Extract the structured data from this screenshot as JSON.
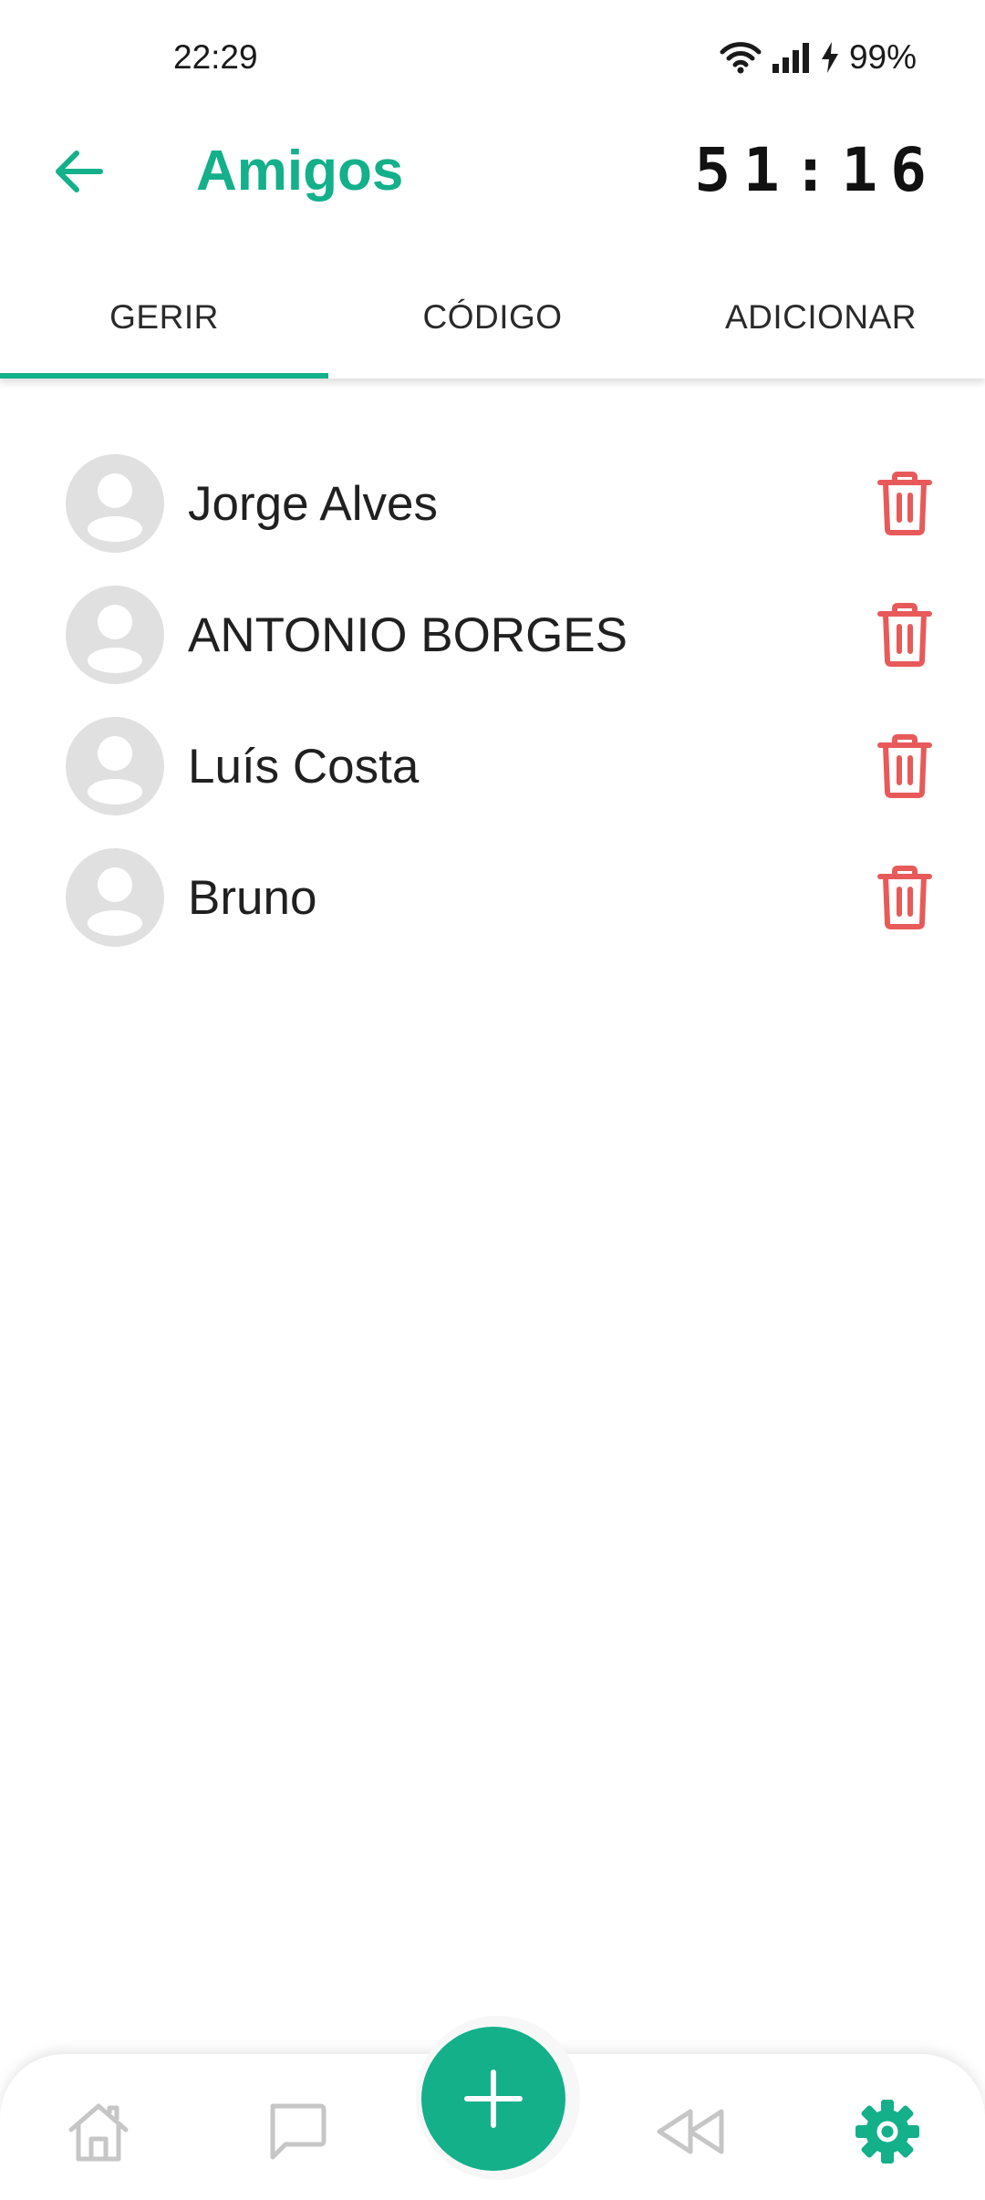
{
  "status_bar": {
    "time": "22:29",
    "battery": "99%"
  },
  "app_bar": {
    "title": "Amigos",
    "timer": "51:16"
  },
  "tabs": [
    {
      "label": "GERIR",
      "active": true
    },
    {
      "label": "CÓDIGO",
      "active": false
    },
    {
      "label": "ADICIONAR",
      "active": false
    }
  ],
  "friends": [
    {
      "name": "Jorge Alves"
    },
    {
      "name": "ANTONIO BORGES"
    },
    {
      "name": "Luís Costa"
    },
    {
      "name": "Bruno"
    }
  ],
  "bottom_nav": {
    "items": [
      "home-icon",
      "chat-icon",
      "add-icon",
      "rewind-icon",
      "settings-icon"
    ],
    "active": "settings-icon"
  },
  "colors": {
    "accent": "#13b08a",
    "delete": "#e85a5a",
    "inactive_icon": "#c6c6c6",
    "avatar_bg": "#e0e0e0"
  }
}
